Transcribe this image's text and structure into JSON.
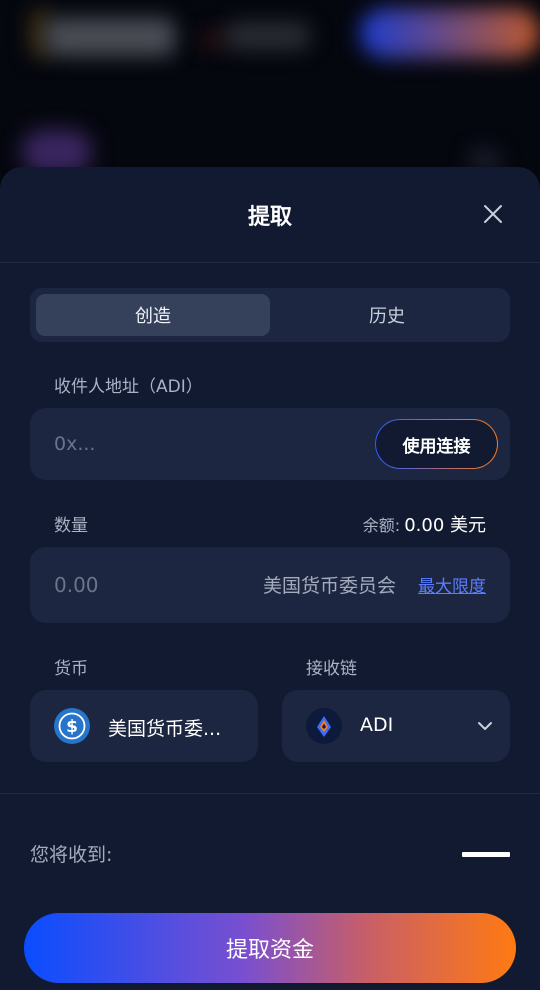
{
  "dialog": {
    "title": "提取"
  },
  "tabs": [
    {
      "label": "创造",
      "active": true
    },
    {
      "label": "历史",
      "active": false
    }
  ],
  "recipient": {
    "label": "收件人地址（ADI）",
    "placeholder": "0x...",
    "value": "",
    "connect_label": "使用连接"
  },
  "amount": {
    "label": "数量",
    "balance_label": "余额:",
    "balance_value": "0.00 美元",
    "placeholder": "0.00",
    "value": "",
    "unit": "美国货币委员会",
    "max_label": "最大限度"
  },
  "currency": {
    "label": "货币",
    "selected": "美国货币委...",
    "icon": "usdc-icon"
  },
  "chain": {
    "label": "接收链",
    "selected": "ADI",
    "icon": "adi-chain-icon"
  },
  "receive": {
    "label": "您将收到:",
    "value": "—"
  },
  "submit": {
    "label": "提取资金"
  },
  "colors": {
    "sheet_bg": "#111a30",
    "field_bg": "#1c2640",
    "accent_blue": "#0a4dff",
    "accent_orange": "#ff7a12",
    "link": "#5b7cff"
  }
}
